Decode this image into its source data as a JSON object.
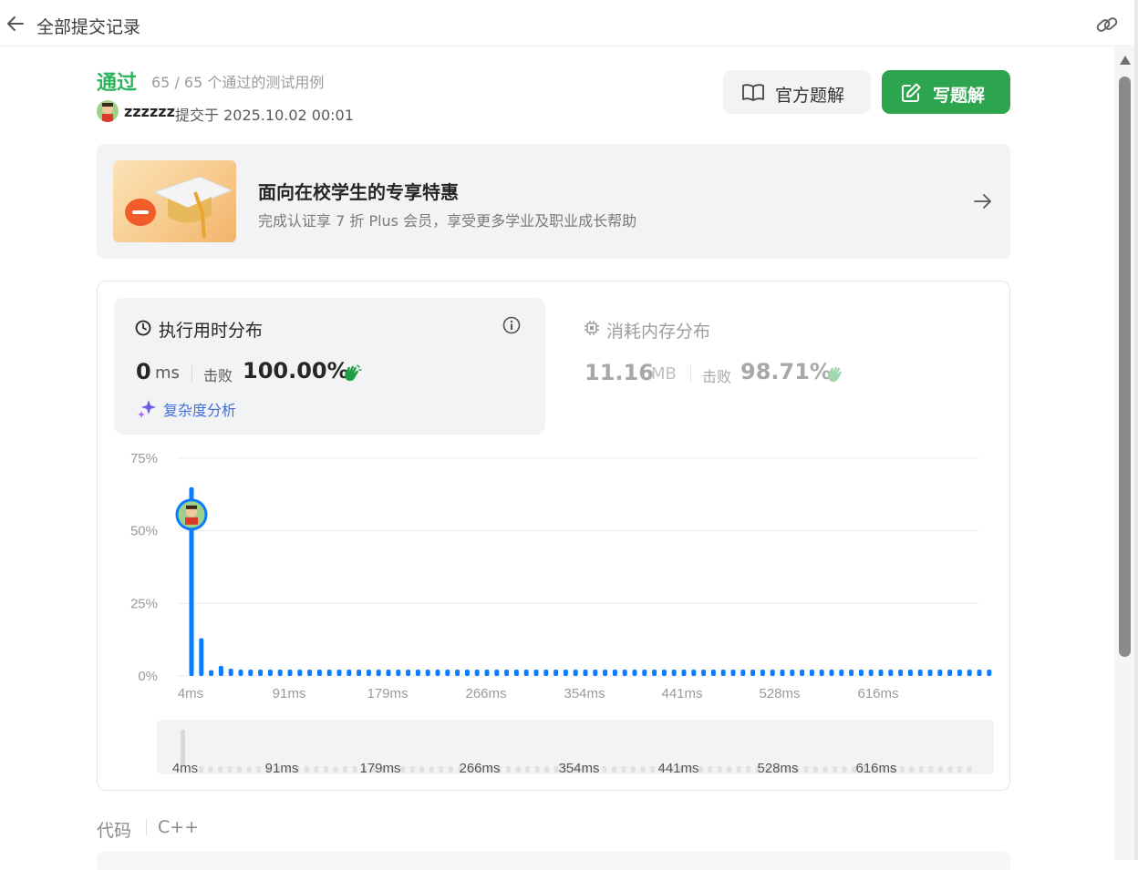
{
  "header": {
    "back_icon": "arrow-left-icon",
    "title": "全部提交记录",
    "share_icon": "link-icon"
  },
  "submission": {
    "status": "通过",
    "testcases": "65 / 65 个通过的测试用例",
    "user": "zzzzzz",
    "submitted_at": "提交于 2025.10.02 00:01",
    "status_color": "#2db55d"
  },
  "actions": {
    "official_solution": "官方题解",
    "write_solution": "写题解",
    "write_color": "#2da44e"
  },
  "promo": {
    "title": "面向在校学生的专享特惠",
    "subtitle": "完成认证享 7 折 Plus 会员，享受更多学业及职业成长帮助"
  },
  "runtime": {
    "title": "执行用时分布",
    "value": "0",
    "unit": "ms",
    "beat_label": "击败",
    "beat_value": "100.00%",
    "complexity_link": "复杂度分析"
  },
  "memory": {
    "title": "消耗内存分布",
    "value": "11.16",
    "unit": "MB",
    "beat_label": "击败",
    "beat_value": "98.71%"
  },
  "chart_data": {
    "type": "bar",
    "yticks": [
      "75%",
      "50%",
      "25%",
      "0%"
    ],
    "ylim": [
      0,
      75
    ],
    "xticks": [
      "4ms",
      "91ms",
      "179ms",
      "266ms",
      "354ms",
      "441ms",
      "528ms",
      "616ms"
    ],
    "values": [
      65,
      13,
      2,
      3.5,
      2.5,
      2.2,
      2.2,
      2.2,
      2.2,
      2.2,
      2.2,
      2.2,
      2.2,
      2.2,
      2.2,
      2.2,
      2.2,
      2.2,
      2.2,
      2.2,
      2.2,
      2.2,
      2.2,
      2.2,
      2.2,
      2.2,
      2.2,
      2.2,
      2.2,
      2.2,
      2.2,
      2.2,
      2.2,
      2.2,
      2.2,
      2.2,
      2.2,
      2.2,
      2.2,
      2.2,
      2.2,
      2.2,
      2.2,
      2.2,
      2.2,
      2.2,
      2.2,
      2.2,
      2.2,
      2.2,
      2.2,
      2.2,
      2.2,
      2.2,
      2.2,
      2.2,
      2.2,
      2.2,
      2.2,
      2.2,
      2.2,
      2.2,
      2.2,
      2.2,
      2.2,
      2.2,
      2.2,
      2.2,
      2.2,
      2.2,
      2.2,
      2.2,
      2.2,
      2.2,
      2.2,
      2.2,
      2.2,
      2.2,
      2.2,
      2.2,
      2.2,
      2.2
    ],
    "highlight_index": 0,
    "grid": true,
    "bar_color": "#0a7cff",
    "grid_color": "#ececec"
  },
  "code": {
    "label": "代码",
    "language": "C++"
  }
}
